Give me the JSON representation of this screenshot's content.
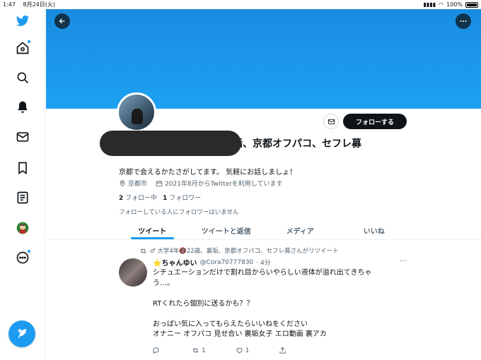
{
  "statusbar": {
    "time": "1:47",
    "date": "8月24日(火)",
    "battery": "100%"
  },
  "nav": {
    "items": [
      {
        "name": "twitter-logo-icon"
      },
      {
        "name": "home-icon"
      },
      {
        "name": "explore-icon"
      },
      {
        "name": "notifications-icon"
      },
      {
        "name": "messages-icon"
      },
      {
        "name": "bookmarks-icon"
      },
      {
        "name": "lists-icon"
      },
      {
        "name": "profile-icon"
      },
      {
        "name": "more-icon"
      }
    ],
    "compose": "compose-tweet-icon"
  },
  "profile": {
    "follow_label": "フォローする",
    "name_visible": "垢、京都オフパコ、セフレ募",
    "bio": "京都で会えるかたさがしてます。 気軽にお話しましょ！",
    "location": "京都市",
    "joined": "2021年8月からTwitterを利用しています",
    "following_count": "2",
    "following_label": "フォロー中",
    "followers_count": "1",
    "followers_label": "フォロワー",
    "known_followers": "フォローしている人にフォロワーはいません"
  },
  "tabs": [
    "ツイート",
    "ツイートと返信",
    "メディア",
    "いいね"
  ],
  "tweet": {
    "retweet_text": "♂ 大学4年🔞22歳。裏垢、京都オフパコ、セフレ募さんがリツイート",
    "author_name": "⭐️ちゃんゆい",
    "author_handle": "@Cora70777830",
    "time": "· 4分",
    "lines": [
      "シチュエーションだけで割れ目からいやらしい液体が溢れ出てきちゃ",
      "う…。",
      "",
      "RTくれたら個別に送るかも？？",
      "",
      "おっぱい気に入ってもらえたらいいねをください",
      "オナニー オフパコ 見せ合い 裏垢女子 エロ動画 裏アカ"
    ],
    "replies": "",
    "retweets": "1",
    "likes": "1"
  },
  "colors": {
    "accent": "#1d9bf0",
    "banner": "#1da1f2"
  }
}
